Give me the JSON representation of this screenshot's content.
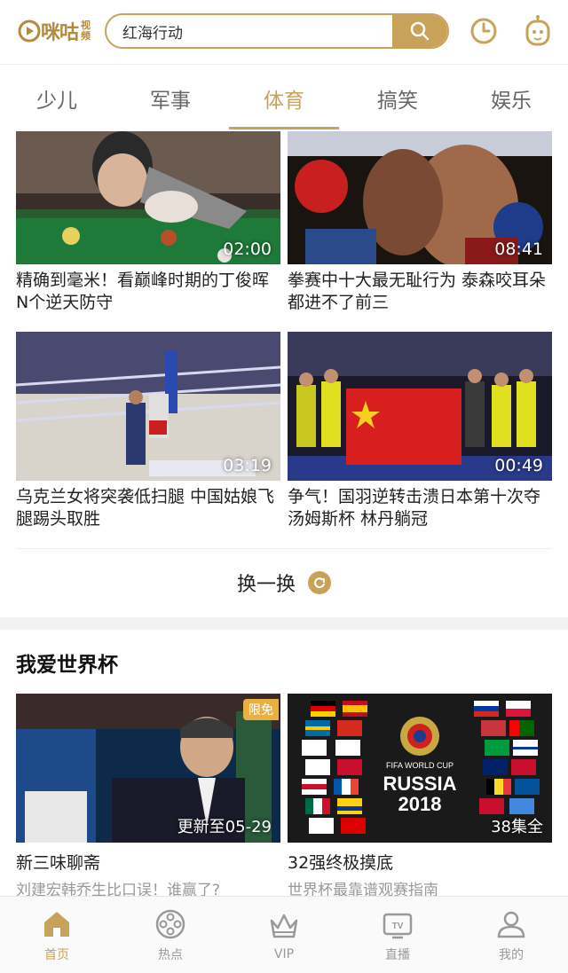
{
  "header": {
    "logo_text": "咪咕",
    "logo_sub_1": "视",
    "logo_sub_2": "频",
    "search_value": "红海行动"
  },
  "tabs": [
    {
      "label": "少儿"
    },
    {
      "label": "军事"
    },
    {
      "label": "体育",
      "active": true
    },
    {
      "label": "搞笑"
    },
    {
      "label": "娱乐"
    }
  ],
  "videos": [
    {
      "duration": "02:00",
      "caption": "精确到毫米！看巅峰时期的丁俊晖N个逆天防守"
    },
    {
      "duration": "08:41",
      "caption": "拳赛中十大最无耻行为 泰森咬耳朵都进不了前三"
    },
    {
      "duration": "03:19",
      "caption": "乌克兰女将突袭低扫腿 中国姑娘飞腿踢头取胜"
    },
    {
      "duration": "00:49",
      "caption": "争气！国羽逆转击溃日本第十次夺汤姆斯杯 林丹躺冠"
    }
  ],
  "refresh": {
    "label": "换一换"
  },
  "section": {
    "title": "我爱世界杯",
    "items": [
      {
        "badge": "限免",
        "overlay": "更新至05-29",
        "title": "新三味聊斋",
        "subtitle": "刘建宏韩乔生比口误！谁赢了?"
      },
      {
        "overlay": "38集全",
        "title": "32强终极摸底",
        "subtitle": "世界杯最靠谱观赛指南",
        "poster_line1": "FIFA WORLD CUP",
        "poster_line2": "RUSSIA",
        "poster_line3": "2018"
      }
    ]
  },
  "bottom_nav": [
    {
      "label": "首页",
      "icon": "home-icon",
      "active": true
    },
    {
      "label": "热点",
      "icon": "film-reel-icon"
    },
    {
      "label": "VIP",
      "icon": "crown-icon"
    },
    {
      "label": "直播",
      "icon": "tv-icon"
    },
    {
      "label": "我的",
      "icon": "user-icon"
    }
  ],
  "colors": {
    "accent": "#c9a25a"
  }
}
